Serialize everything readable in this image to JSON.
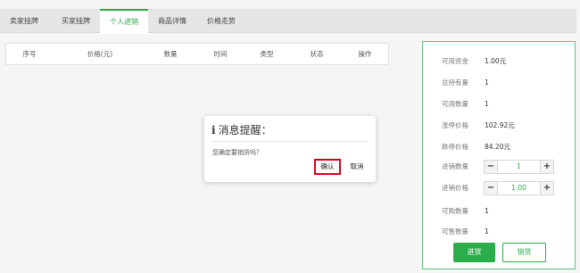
{
  "tabs": [
    {
      "label": "卖家挂牌"
    },
    {
      "label": "买家挂牌"
    },
    {
      "label": "个人进销"
    },
    {
      "label": "商品详情"
    },
    {
      "label": "价格走势"
    }
  ],
  "active_tab": "个人进销",
  "table": {
    "headers": [
      "序号",
      "价格(元)",
      "数量",
      "时间",
      "类型",
      "状态",
      "操作"
    ]
  },
  "panel": {
    "available_funds": {
      "label": "可用资金",
      "value": "1.00元"
    },
    "total_holdings": {
      "label": "总持有量",
      "value": "1"
    },
    "available_qty": {
      "label": "可用数量",
      "value": "1"
    },
    "limit_up_price": {
      "label": "涨停价格",
      "value": "102.92元"
    },
    "limit_down_price": {
      "label": "跌停价格",
      "value": "84.20元"
    },
    "purchase_qty": {
      "label": "进销数量",
      "value": "1",
      "minus": "−",
      "plus": "+"
    },
    "purchase_price": {
      "label": "进销价格",
      "value": "1.00",
      "minus": "−",
      "plus": "+"
    },
    "buyable_qty": {
      "label": "可购数量",
      "value": "1"
    },
    "sellable_qty": {
      "label": "可售数量",
      "value": "1"
    },
    "buy_button": "进货",
    "sell_button": "销货"
  },
  "dialog": {
    "icon": "info-icon",
    "icon_glyph": "i",
    "title": "消息提醒：",
    "message": "您确定要销货吗？",
    "ok": "确认",
    "cancel": "取消"
  },
  "colors": {
    "accent": "#2aae4a",
    "panel_border": "#5cc07a",
    "highlight": "#d0021b"
  }
}
